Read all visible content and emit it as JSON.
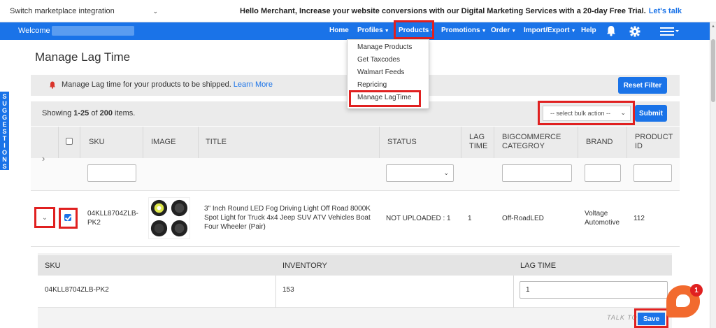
{
  "topbar": {
    "marketplace_select": "Switch marketplace integration",
    "promo_text": "Hello Merchant, Increase your website conversions with our Digital Marketing Services with a 20-day Free Trial.",
    "promo_link": "Let's talk"
  },
  "navbar": {
    "welcome": "Welcome",
    "items": {
      "home": "Home",
      "profiles": "Profiles",
      "products": "Products",
      "promotions": "Promotions",
      "order": "Order",
      "import_export": "Import/Export",
      "help": "Help"
    }
  },
  "products_menu": [
    "Manage Products",
    "Get Taxcodes",
    "Walmart Feeds",
    "Repricing",
    "Manage LagTime"
  ],
  "sidebar_tab": "SUGGESTIONS",
  "page": {
    "title": "Manage Lag Time",
    "info_text": "Manage Lag time for your products to be shipped.",
    "learn_more": "Learn More",
    "reset_filter": "Reset Filter",
    "showing_prefix": "Showing",
    "showing_range": "1-25",
    "showing_of": "of",
    "showing_total": "200",
    "showing_suffix": "items.",
    "bulk_action_placeholder": "-- select bulk action --",
    "submit": "Submit"
  },
  "table": {
    "columns": {
      "sku": "SKU",
      "image": "IMAGE",
      "title": "TITLE",
      "status": "STATUS",
      "lag_time_1": "LAG",
      "lag_time_2": "TIME",
      "category_1": "BIGCOMMERCE",
      "category_2": "CATEGROY",
      "brand": "BRAND",
      "product_id_1": "PRODUCT",
      "product_id_2": "ID"
    },
    "row": {
      "sku_1": "04KLL8704ZLB-",
      "sku_2": "PK2",
      "title_1": "3\" Inch Round LED Fog Driving Light Off Road 8000K",
      "title_2": "Spot Light for Truck 4x4 Jeep SUV ATV Vehicles Boat",
      "title_3": "Four Wheeler (Pair)",
      "status": "NOT UPLOADED : 1",
      "lag_time": "1",
      "category": "Off-RoadLED",
      "brand_1": "Voltage",
      "brand_2": "Automotive",
      "product_id": "112"
    }
  },
  "subtable": {
    "columns": {
      "sku": "SKU",
      "inventory": "INVENTORY",
      "lag_time": "LAG TIME"
    },
    "row": {
      "sku": "04KLL8704ZLB-PK2",
      "inventory": "153",
      "lag_time": "1"
    },
    "save": "Save"
  },
  "chat": {
    "badge": "1",
    "talk_to": "TALK TO"
  },
  "colors": {
    "primary": "#1a73e8",
    "highlight": "#e02020",
    "chat": "#f26a2e"
  }
}
